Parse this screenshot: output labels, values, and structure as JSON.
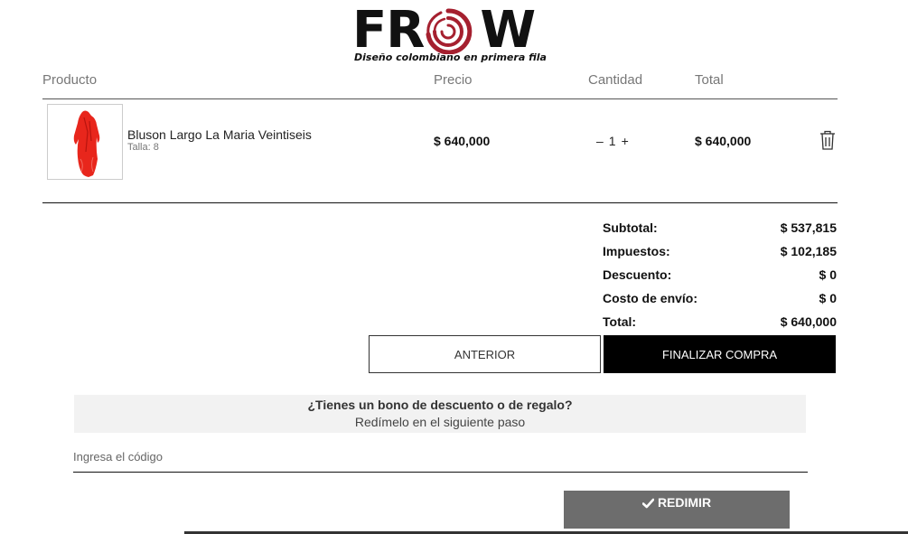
{
  "brand": {
    "letters_left": "FR",
    "letters_right": "W",
    "tagline": "Diseño colombiano en primera fila",
    "accent_color": "#a5202f",
    "logo_icon": "swirl-o-icon"
  },
  "cart_header": {
    "product": "Producto",
    "price": "Precio",
    "quantity": "Cantidad",
    "total": "Total"
  },
  "cart_items": [
    {
      "name": "Bluson Largo La Maria Veintiseis",
      "size": "Talla: 8",
      "price": "$ 640,000",
      "quantity": "1",
      "decrement": "–",
      "increment": "+",
      "total": "$ 640,000",
      "image_icon": "red-dress-thumbnail",
      "delete_icon": "trash-icon"
    }
  ],
  "summary": {
    "subtotal_label": "Subtotal:",
    "subtotal_value": "$ 537,815",
    "tax_label": "Impuestos:",
    "tax_value": "$ 102,185",
    "discount_label": "Descuento:",
    "discount_value": "$ 0",
    "shipping_label": "Costo de envío:",
    "shipping_value": "$ 0",
    "total_label": "Total:",
    "total_value": "$ 640,000"
  },
  "actions": {
    "previous": "ANTERIOR",
    "finish": "FINALIZAR COMPRA"
  },
  "coupon": {
    "question": "¿Tienes un bono de descuento o de regalo?",
    "hint": "Redímelo en el siguiente paso",
    "placeholder": "Ingresa el código",
    "redeem_label": "REDIMIR",
    "redeem_icon": "check-icon"
  }
}
